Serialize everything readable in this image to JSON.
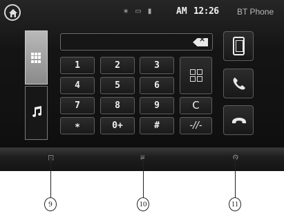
{
  "status_bar": {
    "home_icon": "home-icon",
    "bluetooth_glyph": "∗",
    "battery_glyph": "▭",
    "signal_glyph": "▮",
    "clock_ampm": "AM",
    "clock_time": "12:26",
    "source_label": "BT Phone"
  },
  "side_tabs": [
    {
      "name": "dial-pad-tab",
      "icon": "keypad-icon",
      "active": true
    },
    {
      "name": "music-tab",
      "icon": "music-note-icon",
      "active": false
    }
  ],
  "number_field": {
    "value": "",
    "backspace_label": "×"
  },
  "keypad": {
    "k1": "1",
    "k2": "2",
    "k3": "3",
    "k4": "4",
    "k5": "5",
    "k6": "6",
    "k7": "7",
    "k8": "8",
    "k9": "9",
    "star": "∗",
    "zero": "0+",
    "hash": "#"
  },
  "function_keys": {
    "contacts_icon": "contacts-grid-icon",
    "redial_label": "C",
    "pause_label": "-//-"
  },
  "phone_buttons": {
    "device": "phone-device-icon",
    "call": "call-icon",
    "end": "end-call-icon"
  },
  "callouts": [
    "9",
    "10",
    "11"
  ],
  "colors": {
    "screen_bg": "#141414",
    "key_border": "#5e5e5e",
    "text": "#f0f0f0"
  }
}
